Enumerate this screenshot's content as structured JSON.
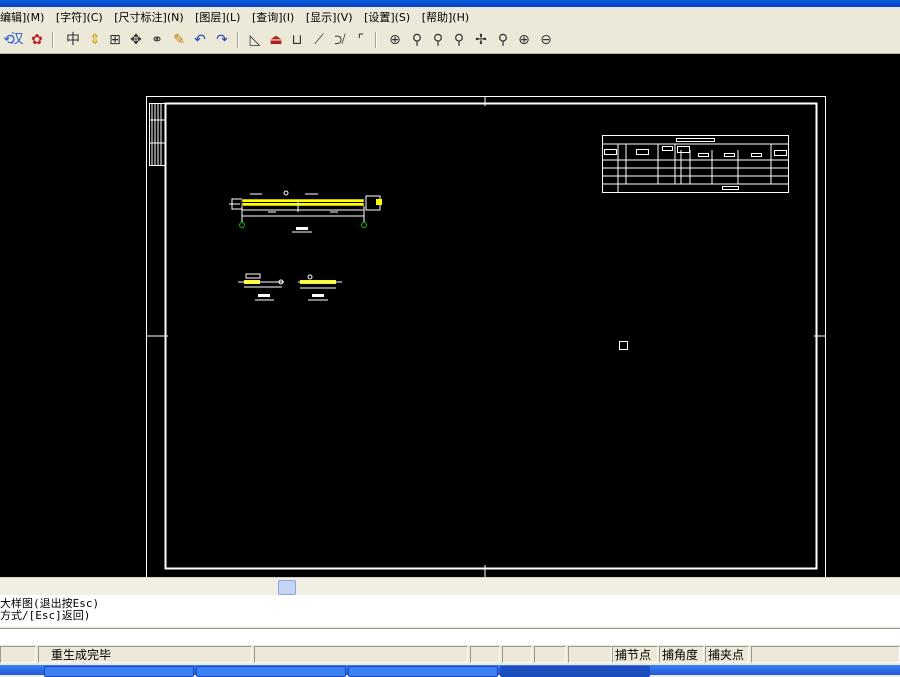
{
  "menu": [
    "编辑](M)",
    "[字符](C)",
    "[尺寸标注](N)",
    "[图层](L)",
    "[查询](I)",
    "[显示](V)",
    "[设置](S)",
    "[帮助](H)"
  ],
  "toolbar": {
    "icons": [
      "undo-text-icon",
      "han-text-icon",
      "color-icon",
      "grid-snap-icon",
      "move-up-down-icon",
      "array-icon",
      "move-icon",
      "copy-icon",
      "edit-icon",
      "undo-icon",
      "redo-icon",
      "rectangle-icon",
      "arc-icon",
      "open-rect-icon",
      "trim-icon",
      "extend-icon",
      "fillet-icon",
      "zoom-window-icon",
      "zoom-realtime-icon",
      "zoom-prev-icon",
      "zoom-all-icon",
      "pan-icon",
      "zoom-extent-icon",
      "zoom-in-icon",
      "zoom-out-icon"
    ]
  },
  "command": {
    "line1": "大样图(退出按Esc)",
    "line2": "方式/[Esc]返回)"
  },
  "status": {
    "message": "重生成完毕",
    "snap_point": "捕节点",
    "snap_angle": "捕角度",
    "snap_clip": "捕夹点"
  },
  "colors": {
    "canvas_bg": "#000000",
    "drawing_line": "#ffffff",
    "highlight_beam": "#ffff00",
    "support_green": "#00c000"
  }
}
